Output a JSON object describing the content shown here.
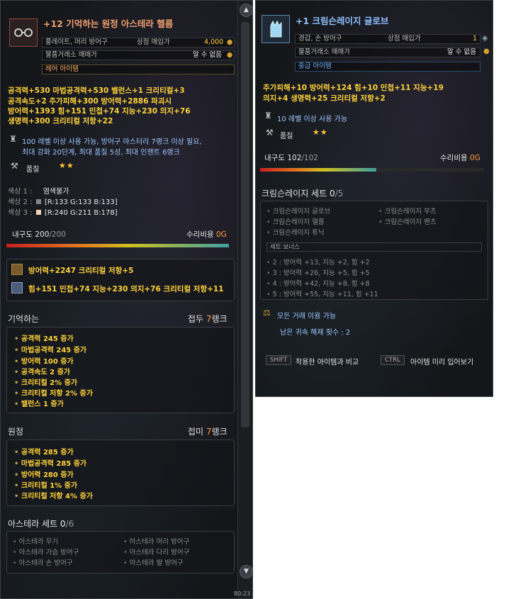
{
  "helm": {
    "title": "+12 기억하는 원정 아스테라 헬름",
    "type": "플레이트, 머리 방어구",
    "shop_label": "상점 매입가",
    "shop_price": "4,000",
    "trade_label": "물품거래소 매매가",
    "trade_value": "알 수 없음",
    "rarity": "레어 아이템",
    "stats": [
      "공격력+530   마법공격력+530   밸런스+1   크리티컬+3",
      "공격속도+2   추가피해+300   방어력+2886   파괴시",
      "방어력+1393  힘+151   민첩+74   지능+230   의지+76",
      "생명력+300   크리티컬 저항+22"
    ],
    "requirement": "100 레벨 이상 사용 가능, 방어구 마스터리 7랭크 이상 필요,",
    "requirement2": "최대 강화 20단계, 최대 품질 5성, 최대 인챈트 6랭크",
    "quality_label": "품질",
    "quality_stars": "★★",
    "colors": [
      {
        "label": "색상 1 :",
        "value": "염색불가",
        "swatch": ""
      },
      {
        "label": "색상 2 :",
        "value": "[R:133 G:133 B:133]",
        "swatch": "#858585"
      },
      {
        "label": "색상 3 :",
        "value": "[R:240 G:211 B:178]",
        "swatch": "#f0d3b2"
      }
    ],
    "durability_label": "내구도",
    "durability_cur": "200",
    "durability_max": "/200",
    "durability_pct": 1.0,
    "repair_label": "수리비용",
    "repair_value": "0",
    "repair_unit": "G",
    "enchant1": "방어력+2247  크리티컬 저항+5",
    "enchant2": "힘+151  민첩+74  지능+230  의지+76  크리티컬 저항+11",
    "section1": {
      "title": "기억하는",
      "rank_prefix": "접두",
      "rank_num": "7",
      "rank_suffix": "랭크",
      "items": [
        "공격력 245 증가",
        "마법공격력 245 증가",
        "방어력 100 증가",
        "공격속도 2 증가",
        "크리티컬 2% 증가",
        "크리티컬 저항 2% 증가",
        "밸런스 1 증가"
      ]
    },
    "section2": {
      "title": "원정",
      "rank_prefix": "접미",
      "rank_num": "7",
      "rank_suffix": "랭크",
      "items": [
        "공격력 285 증가",
        "마법공격력 285 증가",
        "방어력 280 증가",
        "크리티컬 1% 증가",
        "크리티컬 저항 4% 증가"
      ]
    },
    "set": {
      "title": "아스테라 세트",
      "count": "0",
      "total": "/6",
      "items": [
        "아스테라 무기",
        "아스테라 머리 방어구",
        "아스테라 가슴 방어구",
        "아스테라 다리 방어구",
        "아스테라 손 방어구",
        "아스테라 발 방어구"
      ]
    },
    "corner_text": "80:23"
  },
  "glove": {
    "title": "+1 크림슨레이지 글로브",
    "type": "경갑, 손 방어구",
    "shop_label": "상점 매입가",
    "shop_price": "1",
    "trade_label": "물품거래소 매매가",
    "trade_value": "알 수 없음",
    "rarity": "중급 아이템",
    "stats": [
      "추가피해+10   방어력+124   힘+10   민첩+11   지능+19",
      "의지+4   생명력+25   크리티컬 저항+2"
    ],
    "requirement": "10 레벨 이상 사용 가능",
    "quality_label": "품질",
    "quality_stars": "★★",
    "durability_label": "내구도",
    "durability_cur": "102",
    "durability_max": "/102",
    "durability_pct": 0.52,
    "repair_label": "수리비용",
    "repair_value": "0",
    "repair_unit": "G",
    "set": {
      "title": "크림슨레이지 세트",
      "count": "0",
      "total": "/5",
      "items": [
        "크림슨레이지 글로브",
        "크림슨레이지 부츠",
        "크림슨레이지 헬름",
        "크림슨레이지 팬츠",
        "크림슨레이지 튜닉"
      ],
      "bonus_title": "세트 보너스",
      "bonuses": [
        "2 : 방어력 +13, 지능 +2, 힘 +2",
        "3 : 방어력 +26, 지능 +5, 힘 +5",
        "4 : 방어력 +42, 지능 +8, 힘 +8",
        "5 : 방어력 +55, 지능 +11, 힘 +11"
      ]
    },
    "trade_all": "모든 거래 이용 가능",
    "bind_remaining": "남은 귀속 해제 횟수 : 2",
    "key1": "SHIFT",
    "key1_text": "착용한 아이템과 비교",
    "key2": "CTRL",
    "key2_text": "아이템 미리 입어보기"
  }
}
